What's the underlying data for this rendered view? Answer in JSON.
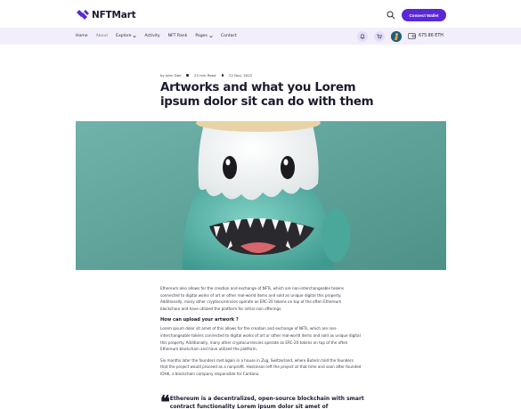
{
  "brand": {
    "name": "NFTMart",
    "accent": "#5a28d6",
    "nav_bg": "#f2effa"
  },
  "header": {
    "connect_label": "Connect Wallet"
  },
  "nav": {
    "items": [
      {
        "label": "Home"
      },
      {
        "label": "About"
      },
      {
        "label": "Explore"
      },
      {
        "label": "Activity"
      },
      {
        "label": "NFT Rank"
      },
      {
        "label": "Pages"
      },
      {
        "label": "Contact"
      }
    ],
    "balance": "675.86 ETH"
  },
  "article": {
    "author": "by John Doe",
    "read_time": "23 min Read",
    "date": "22 Nov, 2022",
    "title": "Artworks and what you Lorem ipsum dolor sit can do with them",
    "para1": "Ethereum also allows for the creation and exchange of NFTs, which are non-interchangeable tokens connected to digital works of art or other real-world items and sold as unique digital this property. Additionally, many other cryptocurrencies operate as ERC-20 tokens on top of the often Ethereum blockchain and have utilized the platform for initial coin offerings.",
    "heading": "How can upload your artwork ?",
    "para2": "Lorem ipsum dolor sit amet of this allows for the creation and exchange of NFTs, which are non-interchangeable tokens connected to digital works of art or other real-world items and sold as unique digital this property. Additionally, many other cryptocurrencies operate as ERC-20 tokens on top of the often Ethereum blockchain and have utilized the platform.",
    "para3": "Six months later the founders met again in a house in Zug, Switzerland, where Buterin told the founders that the project would proceed as a nonprofit. Hoskinson left the project at that time and soon after founded IOHK, a blockchain company responsible for Cardano.",
    "quote": "Ethereum is a decentralized, open-source blockchain with smart contract functionality Lorem ipsum dolor sit amet of"
  },
  "icons": [
    "logo-icon",
    "search-icon",
    "bell-icon",
    "cart-icon",
    "wallet-icon",
    "chevron-down-icon",
    "quote-icon"
  ]
}
